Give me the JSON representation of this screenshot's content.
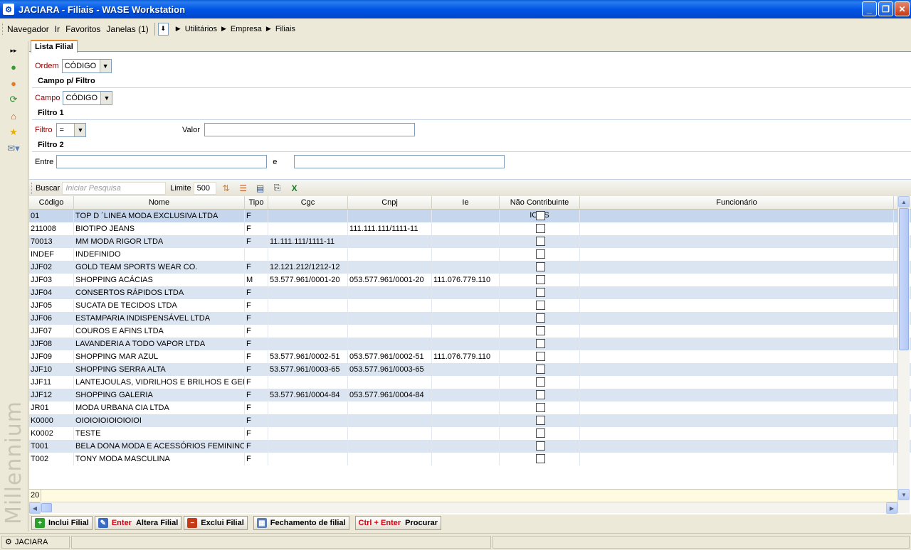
{
  "window": {
    "title": "JACIARA - Filiais - WASE Workstation"
  },
  "menu": {
    "items": [
      "Navegador",
      "Ir",
      "Favoritos",
      "Janelas (1)"
    ],
    "breadcrumb": [
      "Utilitários",
      "Empresa",
      "Filiais"
    ]
  },
  "tab": {
    "label": "Lista Filial"
  },
  "form": {
    "ordem_label": "Ordem",
    "ordem_value": "CÓDIGO",
    "campo_section": "Campo p/ Filtro",
    "campo_label": "Campo",
    "campo_value": "CÓDIGO",
    "filtro1_section": "Filtro 1",
    "filtro_label": "Filtro",
    "filtro_value": "=",
    "valor_label": "Valor",
    "valor_value": "",
    "filtro2_section": "Filtro 2",
    "entre_label": "Entre",
    "entre_from": "",
    "e_label": "e",
    "entre_to": ""
  },
  "toolbar": {
    "buscar_label": "Buscar",
    "search_placeholder": "Iniciar Pesquisa",
    "limite_label": "Limite",
    "limite_value": "500"
  },
  "grid": {
    "columns": [
      "Código",
      "Nome",
      "Tipo",
      "Cgc",
      "Cnpj",
      "Ie",
      "Não Contribuinte ICMS",
      "Funcionário"
    ],
    "rows": [
      [
        "01",
        "TOP D ´LINEA MODA EXCLUSIVA LTDA",
        "F",
        "",
        "",
        "",
        "",
        ""
      ],
      [
        "211008",
        "BIOTIPO JEANS",
        "F",
        "",
        "111.111.111/1111-11",
        "",
        "",
        ""
      ],
      [
        "70013",
        "MM MODA RIGOR LTDA",
        "F",
        "11.111.111/1111-11",
        "",
        "",
        "",
        ""
      ],
      [
        "INDEF",
        "INDEFINIDO",
        "",
        "",
        "",
        "",
        "",
        ""
      ],
      [
        "JJF02",
        "GOLD TEAM SPORTS WEAR CO.",
        "F",
        "12.121.212/1212-12",
        "",
        "",
        "",
        ""
      ],
      [
        "JJF03",
        "SHOPPING ACÁCIAS",
        "M",
        "53.577.961/0001-20",
        "053.577.961/0001-20",
        "111.076.779.110",
        "",
        ""
      ],
      [
        "JJF04",
        "CONSERTOS RÁPIDOS LTDA",
        "F",
        "",
        "",
        "",
        "",
        ""
      ],
      [
        "JJF05",
        "SUCATA DE TECIDOS LTDA",
        "F",
        "",
        "",
        "",
        "",
        ""
      ],
      [
        "JJF06",
        "ESTAMPARIA INDISPENSÁVEL LTDA",
        "F",
        "",
        "",
        "",
        "",
        ""
      ],
      [
        "JJF07",
        "COUROS E AFINS LTDA",
        "F",
        "",
        "",
        "",
        "",
        ""
      ],
      [
        "JJF08",
        "LAVANDERIA A TODO VAPOR LTDA",
        "F",
        "",
        "",
        "",
        "",
        ""
      ],
      [
        "JJF09",
        "SHOPPING MAR AZUL",
        "F",
        "53.577.961/0002-51",
        "053.577.961/0002-51",
        "111.076.779.110",
        "",
        ""
      ],
      [
        "JJF10",
        "SHOPPING SERRA ALTA",
        "F",
        "53.577.961/0003-65",
        "053.577.961/0003-65",
        "",
        "",
        ""
      ],
      [
        "JJF11",
        "LANTEJOULAS, VIDRILHOS E BRILHOS E GERAL",
        "F",
        "",
        "",
        "",
        "",
        ""
      ],
      [
        "JJF12",
        "SHOPPING GALERIA",
        "F",
        "53.577.961/0004-84",
        "053.577.961/0004-84",
        "",
        "",
        ""
      ],
      [
        "JR01",
        "MODA URBANA CIA LTDA",
        "F",
        "",
        "",
        "",
        "",
        ""
      ],
      [
        "K0000",
        "OIOIOIOIOIOIOIOI",
        "F",
        "",
        "",
        "",
        "",
        ""
      ],
      [
        "K0002",
        "TESTE",
        "F",
        "",
        "",
        "",
        "",
        ""
      ],
      [
        "T001",
        "BELA DONA MODA E ACESSÓRIOS FEMININOS",
        "F",
        "",
        "",
        "",
        "",
        ""
      ],
      [
        "T002",
        "TONY MODA MASCULINA",
        "F",
        "",
        "",
        "",
        "",
        ""
      ]
    ],
    "count": "20"
  },
  "actions": {
    "inclui": "Inclui Filial",
    "altera_key": "Enter",
    "altera": "Altera Filial",
    "exclui": "Exclui Filial",
    "fechamento": "Fechamento de filial",
    "procurar_key": "Ctrl + Enter",
    "procurar": "Procurar"
  },
  "status": {
    "user": "JACIARA"
  },
  "brand": "Millennium",
  "colors": {
    "title_bar": "#0055e5",
    "row_alt": "#dbe5f1",
    "key_red": "#d4000f"
  }
}
